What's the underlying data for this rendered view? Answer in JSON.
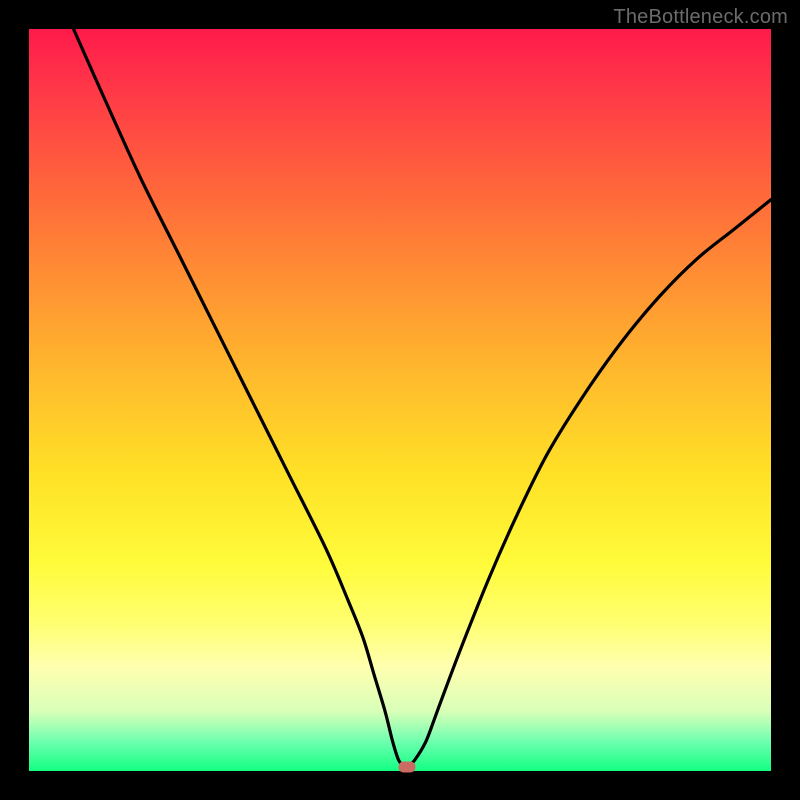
{
  "watermark": "TheBottleneck.com",
  "colors": {
    "curve": "#000000",
    "marker": "#cc6a64",
    "frame": "#000000"
  },
  "chart_data": {
    "type": "line",
    "title": "",
    "xlabel": "",
    "ylabel": "",
    "xlim": [
      0,
      100
    ],
    "ylim": [
      0,
      100
    ],
    "grid": false,
    "legend": false,
    "series": [
      {
        "name": "bottleneck-curve",
        "x": [
          6,
          10,
          15,
          20,
          25,
          30,
          35,
          40,
          43,
          45,
          46.5,
          48,
          49,
          49.8,
          50.5,
          51.2,
          52,
          53.5,
          55,
          58,
          62,
          66,
          70,
          75,
          80,
          85,
          90,
          95,
          100
        ],
        "values": [
          100,
          91,
          80,
          70,
          60,
          50,
          40,
          30,
          23,
          18,
          13,
          8,
          4,
          1.5,
          0.8,
          0.8,
          1.5,
          4,
          8,
          16,
          26,
          35,
          43,
          51,
          58,
          64,
          69,
          73,
          77
        ]
      }
    ],
    "annotations": [
      {
        "name": "min-marker",
        "x": 50.9,
        "y": 0.6
      }
    ],
    "gradient_stops": [
      {
        "pos": 0,
        "color": "#ff1a4a"
      },
      {
        "pos": 18,
        "color": "#ff5a3e"
      },
      {
        "pos": 46,
        "color": "#ffb82d"
      },
      {
        "pos": 72,
        "color": "#fffb3a"
      },
      {
        "pos": 92,
        "color": "#d8ffb8"
      },
      {
        "pos": 100,
        "color": "#12ff82"
      }
    ]
  }
}
